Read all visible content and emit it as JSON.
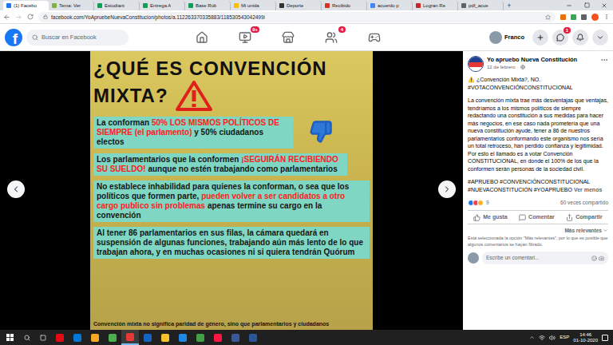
{
  "browser": {
    "tabs": [
      {
        "label": "(1) Facebo",
        "selected": true,
        "color": "#1877f2"
      },
      {
        "label": "Tema: Ver",
        "selected": false,
        "color": "#7cb342"
      },
      {
        "label": "Estudiant",
        "selected": false,
        "color": "#0f9d58"
      },
      {
        "label": "Entrega A",
        "selected": false,
        "color": "#0f9d58"
      },
      {
        "label": "Base Rúb",
        "selected": false,
        "color": "#0f9d58"
      },
      {
        "label": "Mi unida",
        "selected": false,
        "color": "#fbbc04"
      },
      {
        "label": "Deporte",
        "selected": false,
        "color": "#333333"
      },
      {
        "label": "Recibido",
        "selected": false,
        "color": "#d93025"
      },
      {
        "label": "acuerdo p",
        "selected": false,
        "color": "#4285f4"
      },
      {
        "label": "Logran Re",
        "selected": false,
        "color": "#c62828"
      },
      {
        "label": "pdf_acue",
        "selected": false,
        "color": "#5f6368"
      }
    ],
    "new_tab": "+",
    "url": "facebook.com/YoApruebeNuevaConstitucion/photos/a.112263370335883/118530543042499/"
  },
  "header": {
    "logo": "f",
    "search_placeholder": "Buscar en Facebook",
    "nav": [
      {
        "kind": "home",
        "badge": ""
      },
      {
        "kind": "watch",
        "badge": "9+"
      },
      {
        "kind": "marketplace",
        "badge": ""
      },
      {
        "kind": "groups",
        "badge": "4"
      },
      {
        "kind": "gaming",
        "badge": ""
      }
    ],
    "user": "Franco",
    "messenger_badge": "1"
  },
  "image": {
    "title": [
      "¿QUÉ ES CONVENCIÓN",
      "MIXTA?"
    ],
    "blocks": [
      {
        "segments": [
          {
            "text": "La conforman ",
            "highlight": false
          },
          {
            "text": "50% LOS MISMOS POLÍTICOS DE SIEMPRE (el parlamento)",
            "highlight": true
          },
          {
            "text": " y 50% ciudadanos electos",
            "highlight": false
          }
        ]
      },
      {
        "segments": [
          {
            "text": "Los parlamentarios que la conformen ",
            "highlight": false
          },
          {
            "text": "¡SEGUIRÁN RECIBIENDO SU SUELDO!",
            "highlight": true
          },
          {
            "text": " aunque no estén trabajando como parlamentarios",
            "highlight": false
          }
        ]
      },
      {
        "segments": [
          {
            "text": "No establece inhabilidad para quienes la conforman, o sea que los políticos que formen parte, ",
            "highlight": false
          },
          {
            "text": "pueden volver a ser candidatos a otro cargo publico sin  problemas",
            "highlight": true
          },
          {
            "text": " apenas termine su cargo en  la convención",
            "highlight": false
          }
        ]
      },
      {
        "segments": [
          {
            "text": "Al tener 86 parlamentarios en sus filas, la cámara quedará en suspensión de algunas funciones, trabajando aún más lento de lo que trabajan ahora, y en muchas ocasiones ni si quiera tendrán Quórum",
            "highlight": false
          }
        ]
      }
    ],
    "footer": "Convención mixta no significa paridad de género, sino que parlamentarios y ciudadanos"
  },
  "post": {
    "page": "Yo apruebo Nueva Constitución",
    "date": "12 de febrero",
    "date_separator": "·",
    "headline": "⚠️ ¿Convención Mixta?, NO.",
    "hashtag": "#VOTACONVENCIÓNCONSTITUCIONAL",
    "body": "La convención mixta trae más desventajas que ventajas, tendríamos a los mismos políticos de siempre redactando una constitución a sus medidas para hacer más negocios, en ese caso nada prometería que una nueva constitución ayude, tener a 86 de nuestros parlamentarios conformando este organismo nos sería un total retroceso, han perdido confianza y legitimidad. Por esto el llamado es a votar Convención CONSTITUCIONAL, en donde el 100% de los que la conformen serán personas de la sociedad civil.",
    "tags": "#APRUEBO #CONVENCIÓNCONSTITUCIONAL #NUEVACONSTITUCION #YOAPRUEBO",
    "more": "Ver menos",
    "reactions": "9",
    "shares": "60 veces compartido",
    "actions": [
      {
        "kind": "like",
        "label": "Me gusta"
      },
      {
        "kind": "comment",
        "label": "Comentar"
      },
      {
        "kind": "share",
        "label": "Compartir"
      }
    ],
    "sort": "Más relevantes",
    "notice": "Está seleccionada la opción \"Más relevantes\", por lo que es posible que algunos comentarios se hayan filtrado.",
    "comment_placeholder": "Escribe un comentari..."
  },
  "taskbar": {
    "language": "ESP",
    "time": "14:46",
    "date": "01-10-2020"
  }
}
